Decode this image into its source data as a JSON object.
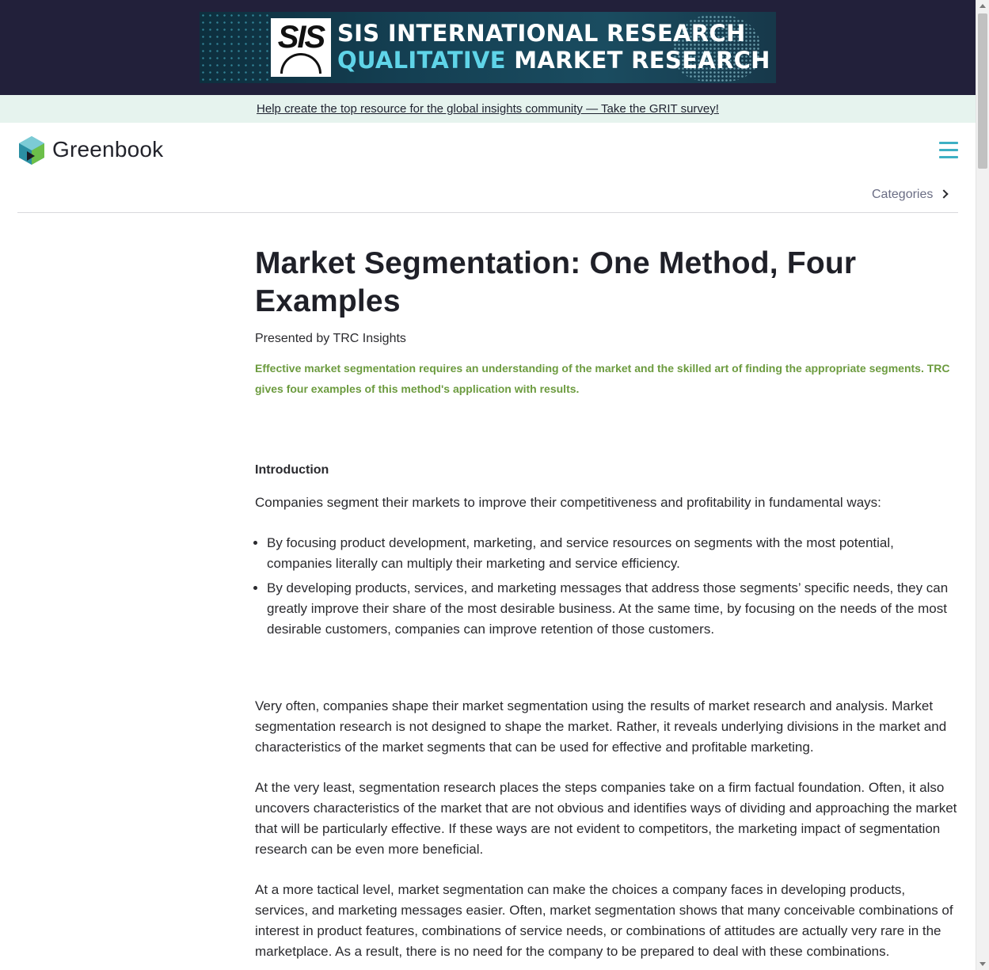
{
  "ad": {
    "logo_text": "SIS",
    "line1": "SIS INTERNATIONAL RESEARCH",
    "line2_accent": "QUALITATIVE",
    "line2_rest": " MARKET RESEARCH"
  },
  "survey_bar": {
    "link_text": "Help create the top resource for the global insights community — Take the GRIT survey!"
  },
  "header": {
    "logo_text": "Greenbook",
    "menu_icon": "hamburger-icon",
    "categories_label": "Categories"
  },
  "article": {
    "title": "Market Segmentation: One Method, Four Examples",
    "presented_by": "Presented by TRC Insights",
    "lede": "Effective market segmentation requires an understanding of the market and the skilled art of finding the appropriate segments. TRC gives four examples of this method's application with results.",
    "section_heading": "Introduction",
    "intro_paragraph": "Companies segment their markets to improve their competitiveness and profitability in fundamental ways:",
    "bullets": [
      "By focusing product development, marketing, and service resources on segments with the most potential, companies literally can multiply their marketing and service efficiency.",
      "By developing products, services, and marketing messages that address those segments’ specific needs, they can greatly improve their share of the most desirable business. At the same time, by focusing on the needs of the most desirable customers, companies can improve retention of those customers."
    ],
    "paragraph_2": "Very often, companies shape their market segmentation using the results of market research and analysis. Market segmentation research is not designed to shape the market. Rather, it reveals underlying divisions in the market and characteristics of the market segments that can be used for effective and profitable marketing.",
    "paragraph_3": "At the very least, segmentation research places the steps companies take on a firm factual foundation. Often, it also uncovers characteristics of the market that are not obvious and identifies ways of dividing and approaching the market that will be particularly effective. If these ways are not evident to competitors, the marketing impact of segmentation research can be even more beneficial.",
    "paragraph_4": "At a more tactical level, market segmentation can make the choices a company faces in developing products, services, and marketing messages easier. Often, market segmentation shows that many conceivable combinations of interest in product features, combinations of service needs, or combinations of attitudes are actually very rare in the marketplace. As a result, there is no need for the company to be prepared to deal with these combinations."
  },
  "colors": {
    "ad_band": "#22203a",
    "survey_bg": "#e6f3ee",
    "accent_teal": "#3db0c4",
    "lede_green": "#6c9b3f"
  }
}
